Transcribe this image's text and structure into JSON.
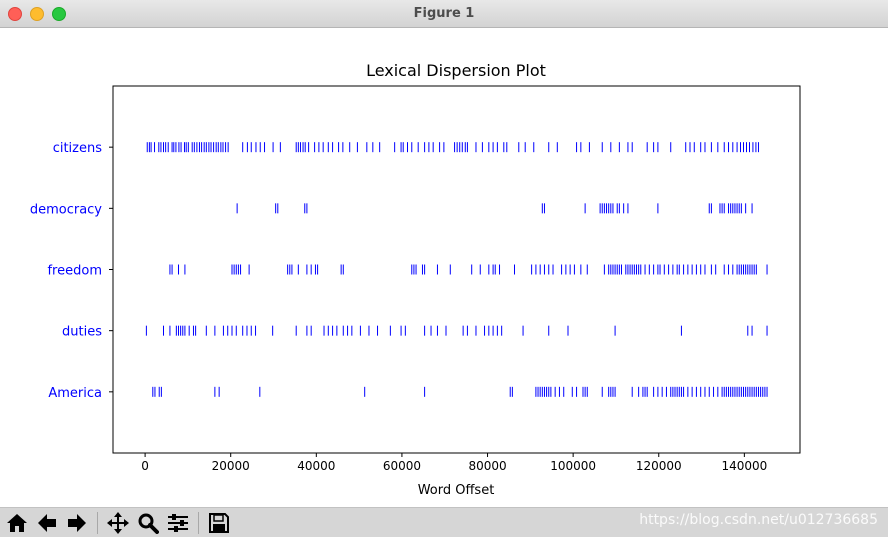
{
  "window": {
    "title": "Figure 1"
  },
  "chart_data": {
    "type": "scatter",
    "title": "Lexical Dispersion Plot",
    "xlabel": "Word Offset",
    "ylabel": "",
    "xlim": [
      -7500,
      153000
    ],
    "xticks": [
      0,
      20000,
      40000,
      60000,
      80000,
      100000,
      120000,
      140000
    ],
    "xtick_labels": [
      "0",
      "20000",
      "40000",
      "60000",
      "80000",
      "100000",
      "120000",
      "140000"
    ],
    "marker": "|",
    "color": "#0000ff",
    "grid": false,
    "series": [
      {
        "name": "citizens",
        "x": [
          500,
          1000,
          1400,
          2200,
          3200,
          3700,
          4300,
          4800,
          5400,
          6300,
          6700,
          7200,
          7900,
          8400,
          9200,
          9600,
          10100,
          11000,
          11500,
          12100,
          12700,
          13200,
          13800,
          14300,
          14900,
          15400,
          16000,
          16600,
          17100,
          17700,
          18200,
          18800,
          19400,
          22800,
          23900,
          24800,
          25900,
          26900,
          27900,
          29900,
          31600,
          35300,
          35800,
          36300,
          36900,
          37400,
          38200,
          39600,
          40600,
          41600,
          42800,
          43800,
          45200,
          46200,
          47800,
          49600,
          51800,
          53200,
          54800,
          58300,
          59800,
          60300,
          61300,
          62300,
          63800,
          65300,
          66300,
          67300,
          68800,
          69800,
          72300,
          72900,
          73500,
          74100,
          74800,
          75300,
          77300,
          78800,
          80300,
          81300,
          82300,
          83800,
          84500,
          87300,
          88800,
          90800,
          94300,
          96300,
          100800,
          101800,
          103800,
          106800,
          108800,
          110800,
          112800,
          113800,
          117300,
          118800,
          119800,
          122800,
          126300,
          127300,
          128300,
          129800,
          130800,
          132300,
          133800,
          135300,
          136300,
          137300,
          138300,
          139100,
          139800,
          140500,
          141200,
          142000,
          142700,
          143300
        ]
      },
      {
        "name": "democracy",
        "x": [
          21500,
          30500,
          31000,
          37300,
          37800,
          92800,
          93300,
          102800,
          106300,
          106800,
          107300,
          107800,
          108300,
          108800,
          109300,
          110300,
          110800,
          111800,
          112800,
          119800,
          131800,
          132300,
          134300,
          134800,
          135300,
          136300,
          136800,
          137300,
          137800,
          138300,
          138800,
          139300,
          140300,
          141800
        ]
      },
      {
        "name": "freedom",
        "x": [
          5800,
          6300,
          7800,
          9300,
          20300,
          20800,
          21300,
          21800,
          22300,
          24300,
          33300,
          33800,
          34300,
          35800,
          37800,
          38800,
          39800,
          40300,
          45800,
          46300,
          62300,
          62800,
          63300,
          64800,
          65300,
          68300,
          71300,
          76300,
          78300,
          80300,
          81300,
          81800,
          82800,
          86300,
          90300,
          91300,
          92300,
          93300,
          94300,
          95300,
          97300,
          98300,
          99300,
          100300,
          101800,
          103300,
          107300,
          108300,
          108800,
          109300,
          109800,
          110300,
          110800,
          111300,
          112300,
          112800,
          113300,
          113800,
          114300,
          114800,
          115300,
          115800,
          116800,
          117800,
          118800,
          119800,
          120300,
          121300,
          122300,
          123300,
          124300,
          124800,
          125800,
          126800,
          127800,
          128800,
          129800,
          130800,
          132300,
          133300,
          135300,
          136300,
          137300,
          138300,
          138800,
          139300,
          139800,
          140300,
          140800,
          141300,
          141800,
          142300,
          142800,
          145300
        ]
      },
      {
        "name": "duties",
        "x": [
          300,
          4300,
          5800,
          7300,
          7800,
          8300,
          8800,
          9300,
          10300,
          11300,
          11800,
          14300,
          16300,
          18300,
          19300,
          20300,
          21300,
          22800,
          23800,
          24800,
          25800,
          29800,
          35300,
          37800,
          38800,
          41800,
          42800,
          43800,
          44800,
          46300,
          47300,
          48300,
          50300,
          52300,
          54300,
          57300,
          59800,
          60800,
          65300,
          66800,
          68300,
          70300,
          74300,
          75300,
          77300,
          79300,
          80300,
          81300,
          82300,
          83300,
          88300,
          94300,
          98800,
          109800,
          125300,
          140800,
          141800,
          145300
        ]
      },
      {
        "name": "America",
        "x": [
          1800,
          2300,
          3300,
          3800,
          16300,
          17300,
          26800,
          51300,
          65300,
          85300,
          85800,
          91300,
          91800,
          92300,
          92800,
          93300,
          93800,
          94300,
          94800,
          95800,
          96800,
          97800,
          99800,
          100800,
          102300,
          102800,
          103300,
          106800,
          108300,
          108800,
          109300,
          109800,
          113800,
          115300,
          116300,
          116800,
          117300,
          118800,
          119800,
          120800,
          121800,
          122800,
          123300,
          123800,
          124300,
          124800,
          125300,
          125800,
          126800,
          127800,
          128800,
          129800,
          130800,
          131800,
          132800,
          133800,
          134800,
          135300,
          135800,
          136300,
          136800,
          137300,
          137800,
          138300,
          138800,
          139300,
          139800,
          140300,
          140800,
          141300,
          141800,
          142300,
          142800,
          143300,
          143800,
          144300,
          144800,
          145300
        ]
      }
    ]
  },
  "toolbar": {
    "items": [
      {
        "id": "home",
        "icon": "home-icon"
      },
      {
        "id": "back",
        "icon": "arrow-left-icon"
      },
      {
        "id": "forward",
        "icon": "arrow-right-icon"
      },
      {
        "id": "pan",
        "icon": "move-icon"
      },
      {
        "id": "zoom",
        "icon": "magnifier-icon"
      },
      {
        "id": "configure",
        "icon": "sliders-icon"
      },
      {
        "id": "save",
        "icon": "floppy-disk-icon"
      }
    ]
  },
  "watermark": "https://blog.csdn.net/u012736685"
}
